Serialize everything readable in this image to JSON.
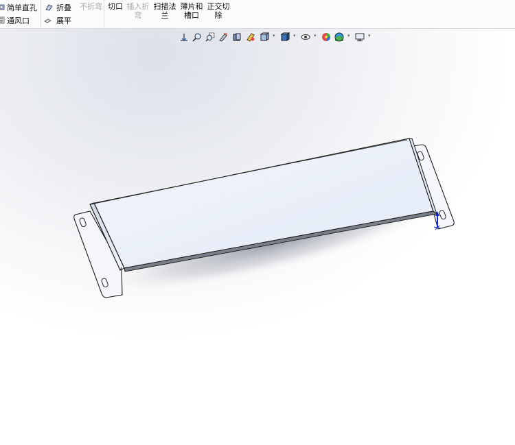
{
  "ribbon": {
    "simple_hole": "简单直孔",
    "vent": "通风口",
    "fold": "折叠",
    "unfold": "不折弯",
    "flatten": "展平",
    "cut": "切口",
    "insert_bend_line1": "插入折",
    "insert_bend_line2": "弯",
    "swept_flange_line1": "扫描法",
    "swept_flange_line2": "兰",
    "tab_slot_line1": "薄片和",
    "tab_slot_line2": "槽口",
    "normal_cut_line1": "正交切",
    "normal_cut_line2": "除"
  },
  "view_toolbar": {
    "icons": [
      "view-orientation-icon",
      "zoom-to-fit-icon",
      "zoom-to-area-icon",
      "previous-view-icon",
      "section-view-icon",
      "dynamic-annotation-icon",
      "view-orientation-menu-icon",
      "display-style-icon",
      "hide-show-items-icon",
      "edit-appearance-icon",
      "apply-scene-icon",
      "view-settings-icon"
    ]
  },
  "colors": {
    "part_face_top": "#e6edf8",
    "part_edge": "#1a1a1a",
    "triad_blue": "#1428c8"
  }
}
